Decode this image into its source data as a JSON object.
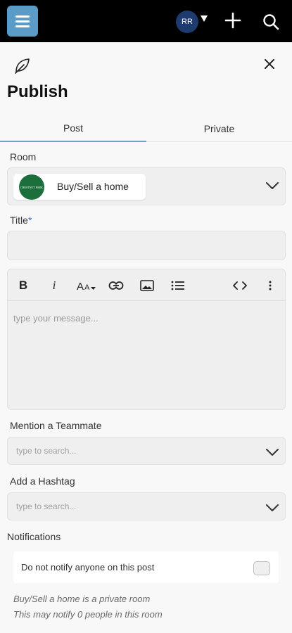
{
  "topbar": {
    "avatar_initials": "RR"
  },
  "panel": {
    "title": "Publish"
  },
  "tabs": [
    {
      "label": "Post",
      "active": true
    },
    {
      "label": "Private",
      "active": false
    }
  ],
  "room": {
    "label": "Room",
    "selected": "Buy/Sell a home",
    "logo_text": "CHESTNUT PARK"
  },
  "title_field": {
    "label": "Title",
    "required_mark": "*",
    "value": ""
  },
  "editor": {
    "placeholder": "type your message...",
    "toolbar": [
      "bold",
      "italic",
      "font-size",
      "link",
      "image",
      "list",
      "code",
      "more"
    ]
  },
  "mention": {
    "label": "Mention a Teammate",
    "placeholder": "type to search..."
  },
  "hashtag": {
    "label": "Add a Hashtag",
    "placeholder": "type to search..."
  },
  "notifications": {
    "label": "Notifications",
    "option": "Do not notify anyone on this post",
    "toggle_on": false,
    "info_line1": "Buy/Sell a home is a private room",
    "info_line2": "This may notify 0 people in this room"
  },
  "colors": {
    "topbar": "#000000",
    "menu_button": "#5b9bc8",
    "avatar": "#1d3b6e",
    "tab_indicator": "#6da2c8",
    "room_logo": "#1c6e3a"
  }
}
